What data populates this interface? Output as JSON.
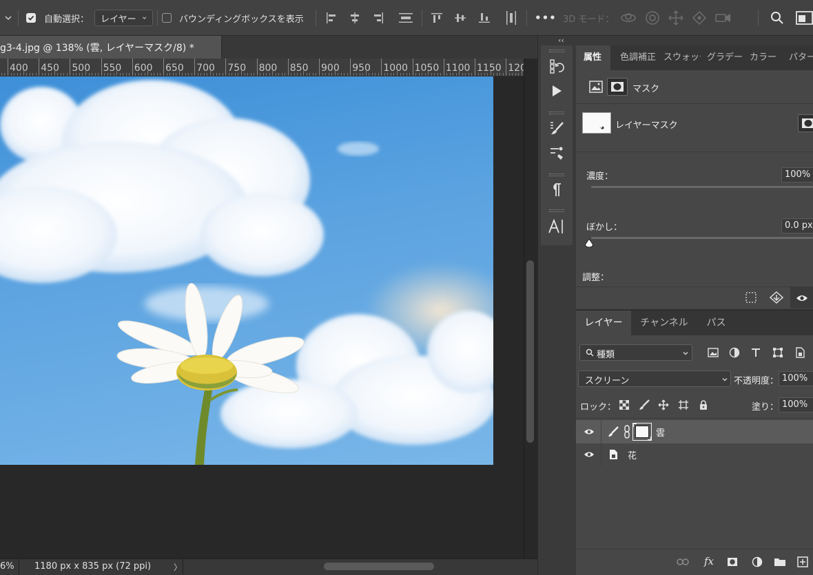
{
  "options_bar": {
    "auto_select_label": "自動選択：",
    "auto_select_checked": true,
    "auto_select_target": "レイヤー",
    "bounding_box_label": "バウンディングボックスを表示",
    "bounding_box_checked": false,
    "more_label": "•••",
    "mode_3d_label": "3D モード："
  },
  "document": {
    "tab_title": "g3-4.jpg @ 138% (雲, レイヤーマスク/8) *",
    "ruler_ticks": [
      "400",
      "450",
      "500",
      "550",
      "600",
      "650",
      "700",
      "750",
      "800",
      "850",
      "900",
      "950",
      "1000",
      "1050",
      "1100",
      "1150",
      "120"
    ],
    "status_zoom": "6%",
    "status_info": "1180 px x 835 px (72 ppi)",
    "status_arrow": "〉"
  },
  "colors": {
    "panel_bg": "#474747",
    "sky": "#5aa2e0",
    "canvas_bg": "#282828"
  },
  "properties": {
    "tabs": [
      "属性",
      "色調補正",
      "スウォッチ",
      "グラデーション",
      "カラー",
      "パターン"
    ],
    "mask_header": "マスク",
    "layer_mask_label": "レイヤーマスク",
    "density_label": "濃度：",
    "density_value": "100%",
    "density_percent": 100,
    "feather_label": "ぼかし：",
    "feather_value": "0.0 px",
    "adjust_label": "調整："
  },
  "layers": {
    "tabs": [
      "レイヤー",
      "チャンネル",
      "パス"
    ],
    "filter_kind": "種類",
    "blend_mode": "スクリーン",
    "opacity_label": "不透明度：",
    "opacity_value": "100%",
    "lock_label": "ロック：",
    "fill_label": "塗り：",
    "fill_value": "100%",
    "items": [
      {
        "name": "雲",
        "selected": true
      },
      {
        "name": "花",
        "selected": false
      }
    ]
  }
}
